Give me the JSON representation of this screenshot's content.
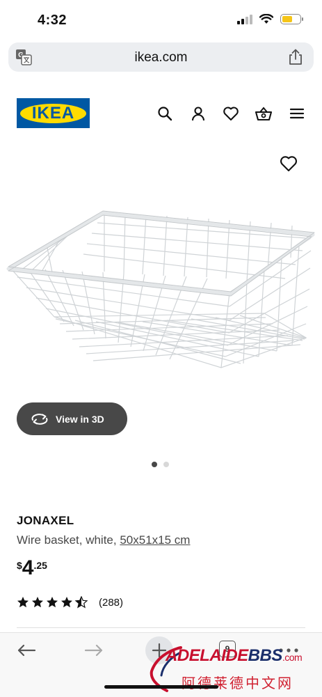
{
  "status_bar": {
    "time": "4:32"
  },
  "browser": {
    "url": "ikea.com",
    "tab_count": "9"
  },
  "header": {
    "logo_text": "IKEA",
    "icons": [
      "search-icon",
      "account-icon",
      "favourites-icon",
      "basket-icon",
      "menu-icon"
    ]
  },
  "product": {
    "view_3d_label": "View in 3D",
    "name": "JONAXEL",
    "description": "Wire basket, white,",
    "size": "50x51x15 cm",
    "price": {
      "currency": "$",
      "integer": "4",
      "decimal": ".25"
    },
    "rating": {
      "stars": 4.5,
      "count": "(288)"
    },
    "carousel": {
      "total": 2,
      "active": 1
    }
  },
  "watermark": {
    "logo_red": "ADELAIDE",
    "logo_dark": "BBS",
    "logo_suffix": ".com",
    "subtitle": "阿德莱德中文网"
  },
  "colors": {
    "ikea_blue": "#0058a3",
    "ikea_yellow": "#ffdb00",
    "button_dark": "#484848",
    "address_bg": "#eceef1"
  }
}
